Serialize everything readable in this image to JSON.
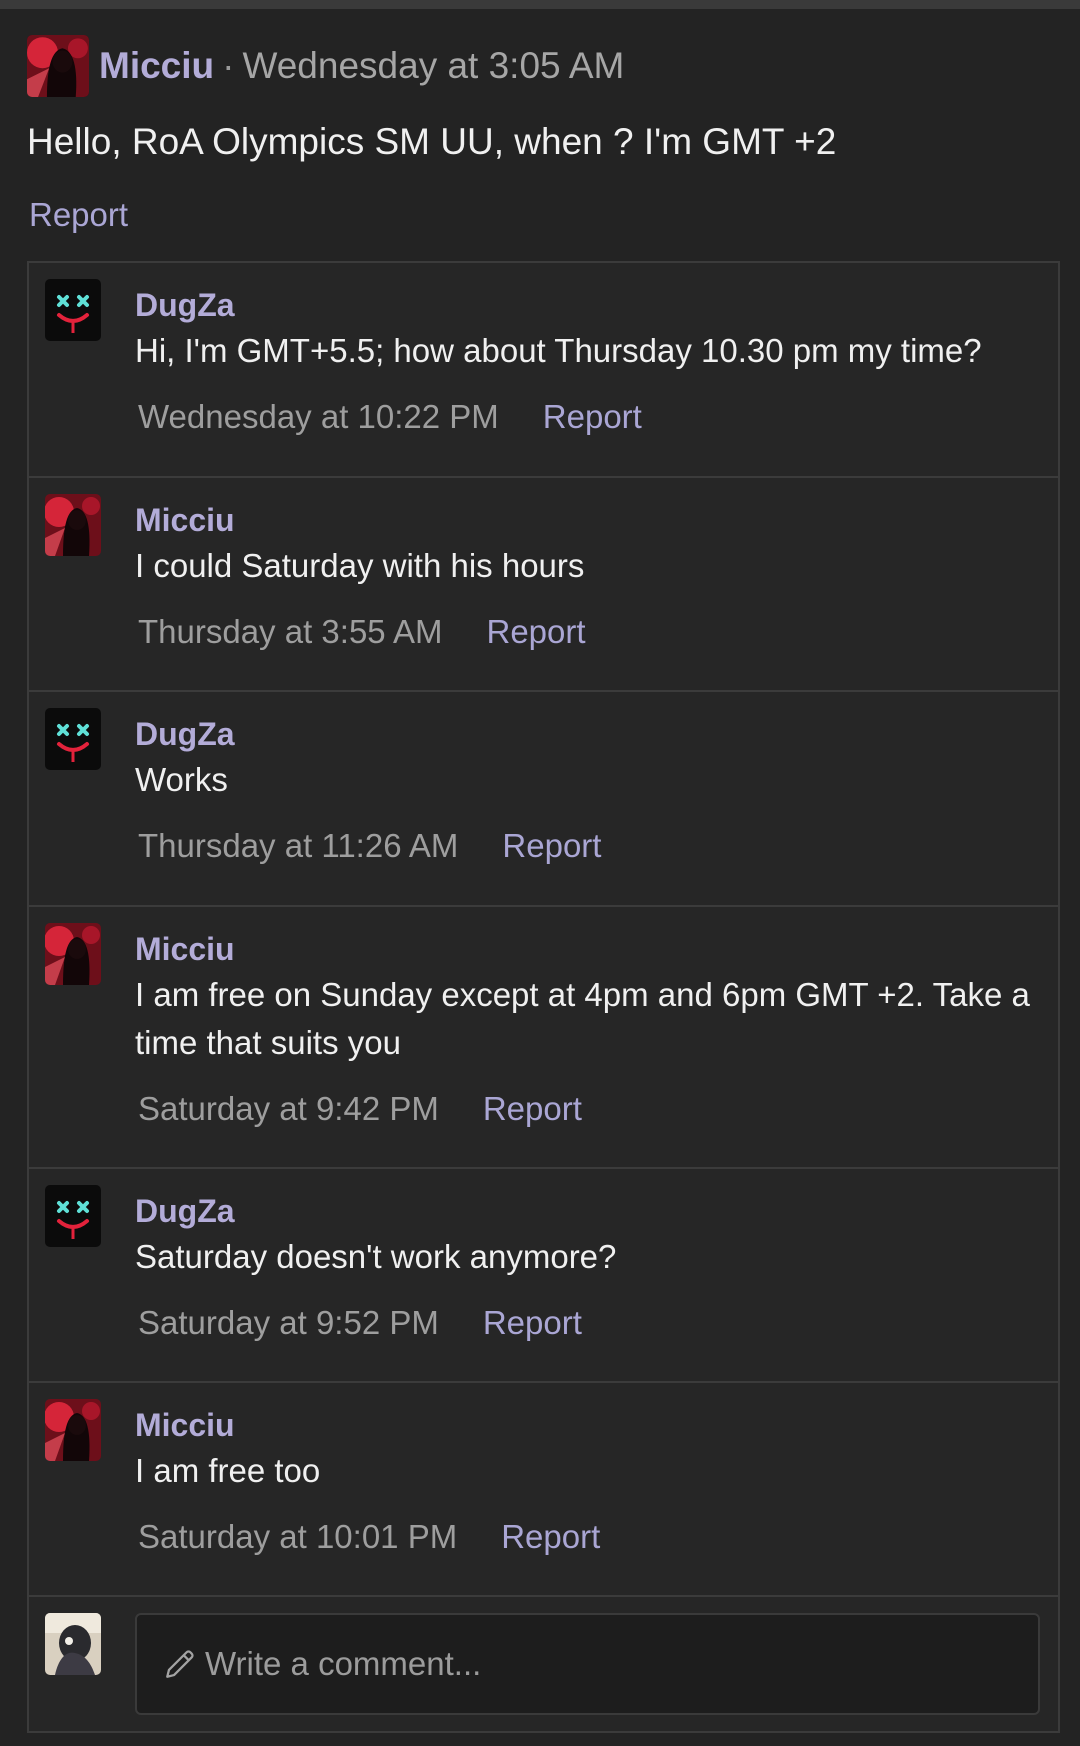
{
  "post": {
    "author": "Micciu",
    "separator": "·",
    "time": "Wednesday at 3:05 AM",
    "text": "Hello, RoA Olympics SM UU, when ? I'm GMT +2",
    "report_label": "Report"
  },
  "comments": [
    {
      "author": "DugZa",
      "avatar": "dugza-avatar",
      "text": "Hi, I'm GMT+5.5; how about Thursday 10.30 pm my time?",
      "time": "Wednesday at 10:22 PM",
      "report_label": "Report"
    },
    {
      "author": "Micciu",
      "avatar": "micciu-avatar",
      "text": "I could Saturday with his hours",
      "time": "Thursday at 3:55 AM",
      "report_label": "Report"
    },
    {
      "author": "DugZa",
      "avatar": "dugza-avatar",
      "text": "Works",
      "time": "Thursday at 11:26 AM",
      "report_label": "Report"
    },
    {
      "author": "Micciu",
      "avatar": "micciu-avatar",
      "text": "I am free on Sunday except at 4pm and 6pm GMT +2. Take a time that suits you",
      "time": "Saturday at 9:42 PM",
      "report_label": "Report"
    },
    {
      "author": "DugZa",
      "avatar": "dugza-avatar",
      "text": "Saturday doesn't work anymore?",
      "time": "Saturday at 9:52 PM",
      "report_label": "Report"
    },
    {
      "author": "Micciu",
      "avatar": "micciu-avatar",
      "text": "I am free too",
      "time": "Saturday at 10:01 PM",
      "report_label": "Report"
    }
  ],
  "composer": {
    "placeholder": "Write a comment...",
    "icon": "pencil-icon"
  },
  "colors": {
    "background": "#232323",
    "author": "#b3acd8",
    "link": "#aaa6d4",
    "muted": "#9e9e9e"
  }
}
